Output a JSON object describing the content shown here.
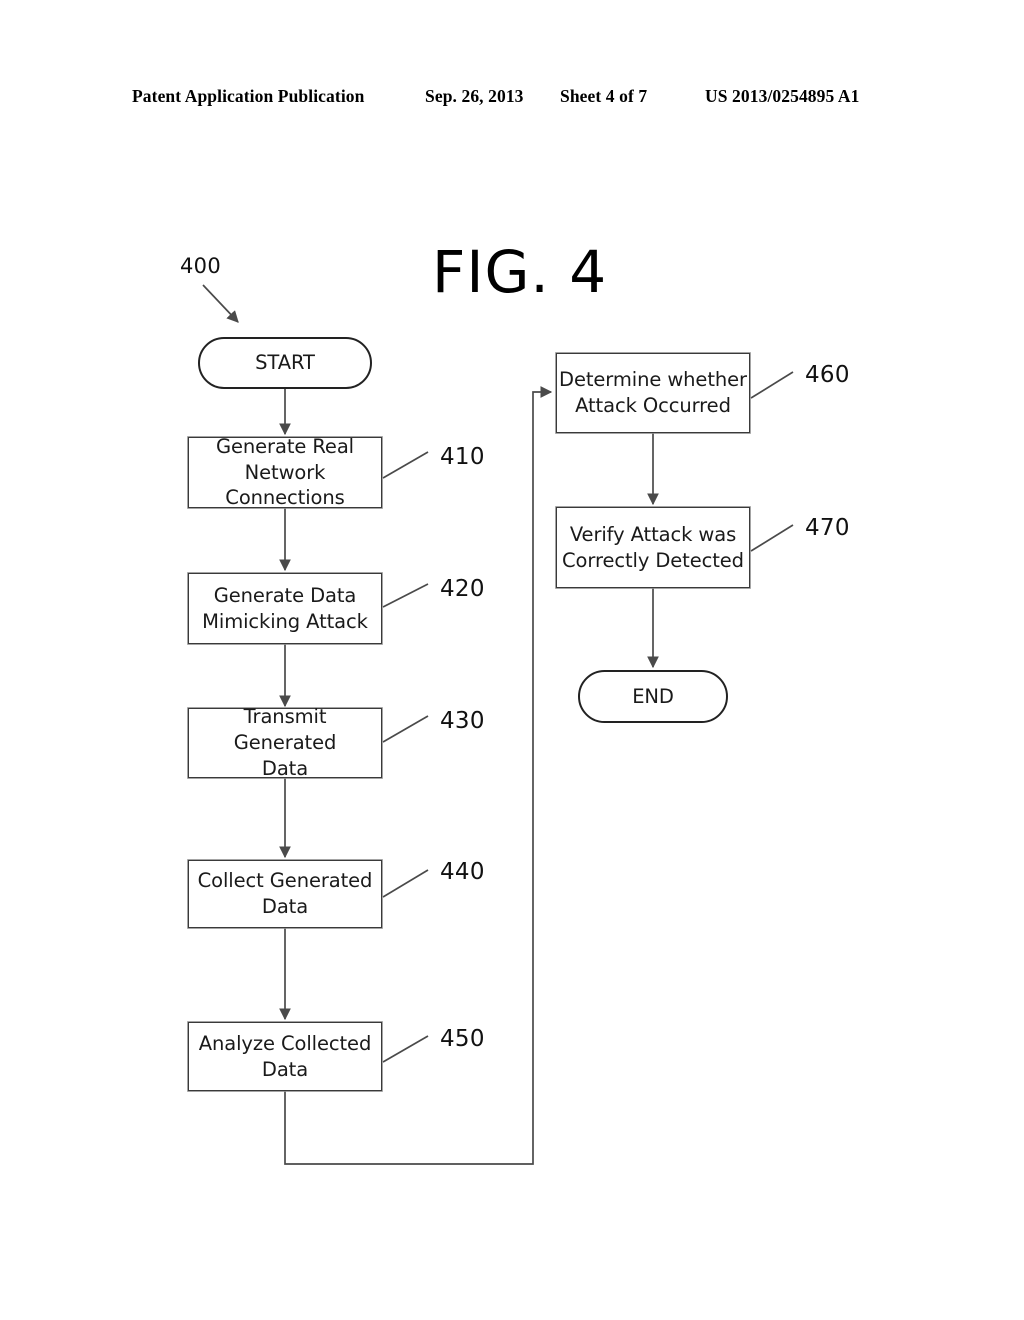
{
  "header": {
    "publication": "Patent Application Publication",
    "date": "Sep. 26, 2013",
    "sheet": "Sheet 4 of 7",
    "patent_number": "US 2013/0254895 A1"
  },
  "figure": {
    "title": "FIG. 4",
    "diagram_numeral": "400"
  },
  "flowchart": {
    "type": "flowchart",
    "nodes": [
      {
        "id": "start",
        "shape": "terminator",
        "label": "START",
        "ref": null
      },
      {
        "id": "n410",
        "shape": "process",
        "label": "Generate Real\nNetwork Connections",
        "ref": "410"
      },
      {
        "id": "n420",
        "shape": "process",
        "label": "Generate Data\nMimicking Attack",
        "ref": "420"
      },
      {
        "id": "n430",
        "shape": "process",
        "label": "Transmit Generated\nData",
        "ref": "430"
      },
      {
        "id": "n440",
        "shape": "process",
        "label": "Collect Generated Data",
        "ref": "440"
      },
      {
        "id": "n450",
        "shape": "process",
        "label": "Analyze Collected Data",
        "ref": "450"
      },
      {
        "id": "n460",
        "shape": "process",
        "label": "Determine whether\nAttack Occurred",
        "ref": "460"
      },
      {
        "id": "n470",
        "shape": "process",
        "label": "Verify Attack was\nCorrectly Detected",
        "ref": "470"
      },
      {
        "id": "end",
        "shape": "terminator",
        "label": "END",
        "ref": null
      }
    ],
    "labels": {
      "start": "START",
      "n410_line1": "Generate Real",
      "n410_line2": "Network Connections",
      "n420_line1": "Generate Data",
      "n420_line2": "Mimicking Attack",
      "n430_line1": "Transmit Generated",
      "n430_line2": "Data",
      "n440_line1": "Collect Generated Data",
      "n450_line1": "Analyze Collected Data",
      "n460_line1": "Determine whether",
      "n460_line2": "Attack Occurred",
      "n470_line1": "Verify Attack was",
      "n470_line2": "Correctly Detected",
      "end": "END"
    },
    "refs": {
      "r400": "400",
      "r410": "410",
      "r420": "420",
      "r430": "430",
      "r440": "440",
      "r450": "450",
      "r460": "460",
      "r470": "470"
    },
    "edges": [
      {
        "from": "start",
        "to": "n410",
        "style": "arrow"
      },
      {
        "from": "n410",
        "to": "n420",
        "style": "arrow"
      },
      {
        "from": "n420",
        "to": "n430",
        "style": "arrow"
      },
      {
        "from": "n430",
        "to": "n440",
        "style": "arrow"
      },
      {
        "from": "n440",
        "to": "n450",
        "style": "arrow"
      },
      {
        "from": "n450",
        "to": "n460",
        "style": "arrow-routed-right"
      },
      {
        "from": "n460",
        "to": "n470",
        "style": "arrow"
      },
      {
        "from": "n470",
        "to": "end",
        "style": "arrow"
      }
    ],
    "colors": {
      "line": "#4a4a4a",
      "box_border": "#3a3a3a",
      "text": "#1a1a1a"
    }
  }
}
